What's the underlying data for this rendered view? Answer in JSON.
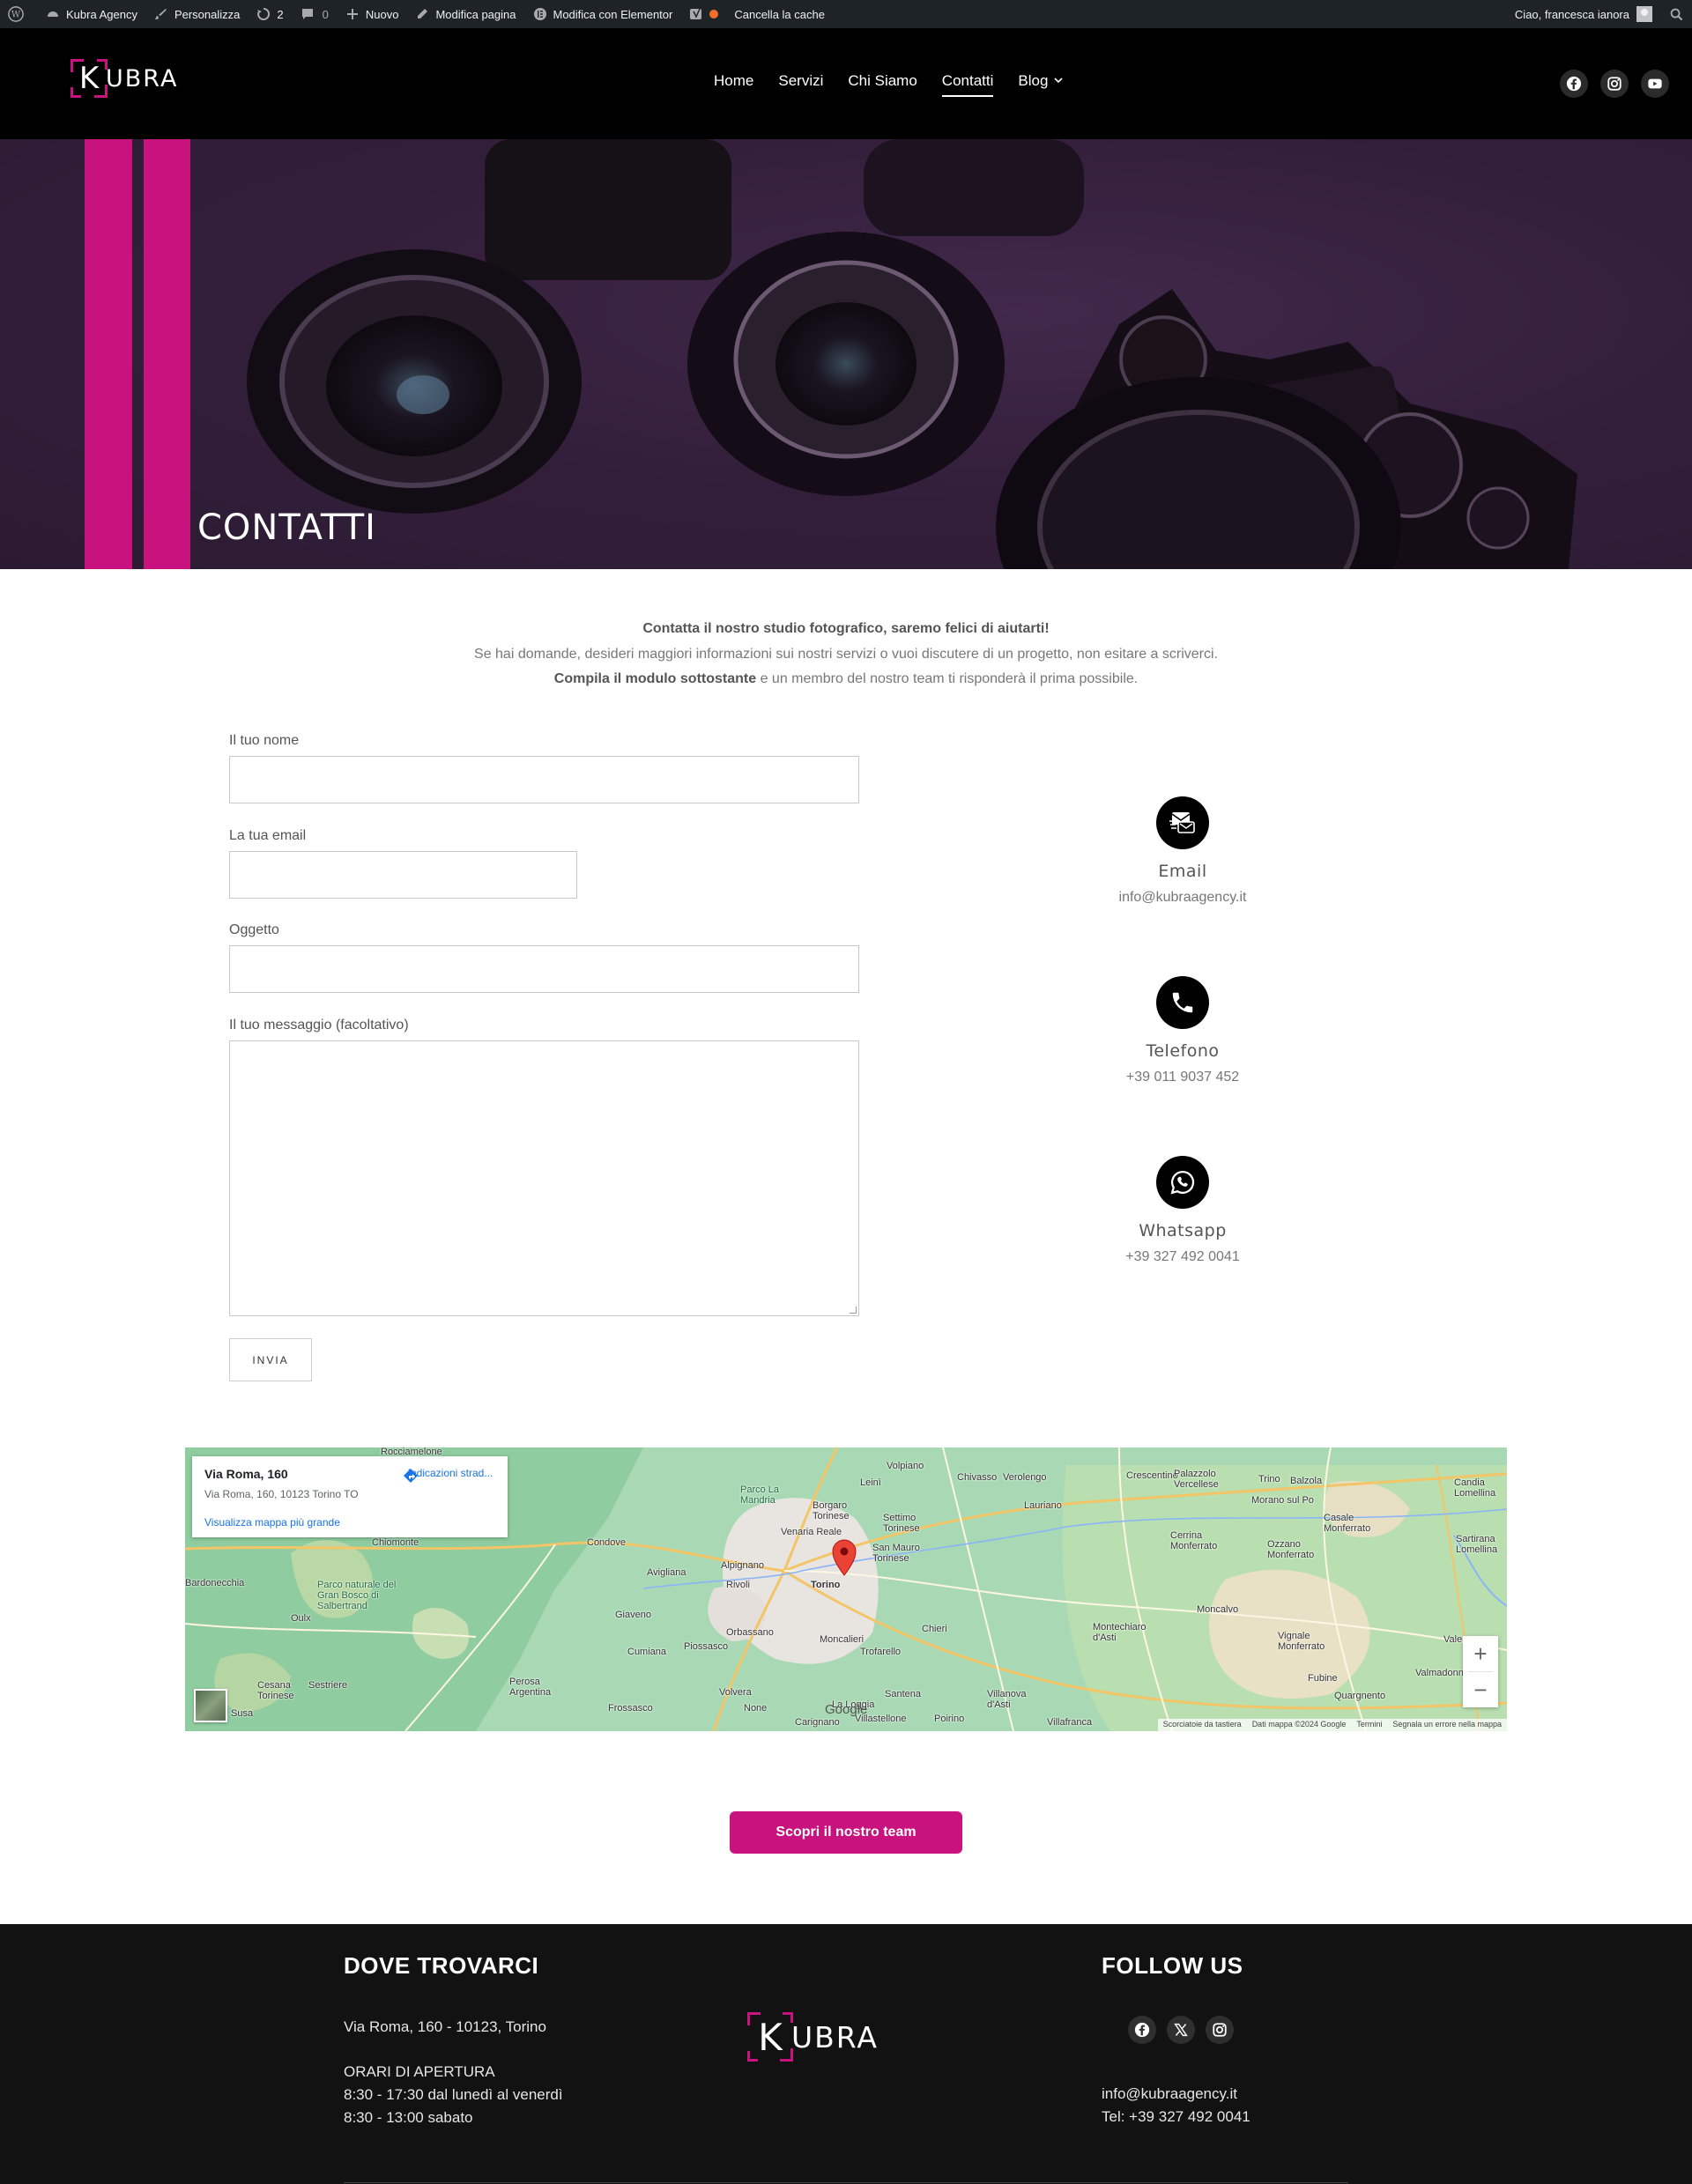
{
  "adminbar": {
    "site": "Kubra Agency",
    "customize": "Personalizza",
    "updates_count": "2",
    "comments_count": "0",
    "new": "Nuovo",
    "edit_page": "Modifica pagina",
    "edit_elementor": "Modifica con Elementor",
    "clear_cache": "Cancella la cache",
    "greeting": "Ciao, francesca ianora"
  },
  "header": {
    "logo_k": "K",
    "logo_rest": "UBRA",
    "nav": [
      {
        "label": "Home"
      },
      {
        "label": "Servizi"
      },
      {
        "label": "Chi Siamo"
      },
      {
        "label": "Contatti"
      },
      {
        "label": "Blog"
      }
    ],
    "active_nav": "Contatti"
  },
  "hero": {
    "title": "CONTATTI"
  },
  "intro": {
    "line1": "Contatta il nostro studio fotografico, saremo felici di aiutarti!",
    "line2": "Se hai domande, desideri maggiori informazioni sui nostri servizi o vuoi discutere di un progetto, non esitare a scriverci.",
    "line3_bold": "Compila il modulo sottostante",
    "line3_rest": " e un membro del nostro team ti risponderà il prima possibile."
  },
  "form": {
    "name_label": "Il tuo nome",
    "name_value": "",
    "email_label": "La tua email",
    "email_value": "",
    "subject_label": "Oggetto",
    "subject_value": "",
    "message_label": "Il tuo messaggio (facoltativo)",
    "message_value": "",
    "submit": "INVIA"
  },
  "contacts": [
    {
      "title": "Email",
      "value": "info@kubraagency.it",
      "icon": "email-icon"
    },
    {
      "title": "Telefono",
      "value": "+39 011 9037 452",
      "icon": "phone-icon"
    },
    {
      "title": "Whatsapp",
      "value": "+39 327 492 0041",
      "icon": "whatsapp-icon"
    }
  ],
  "map": {
    "place_title": "Via Roma, 160",
    "place_address": "Via Roma, 160, 10123 Torino TO",
    "directions": "Indicazioni strad...",
    "bigger_map": "Visualizza mappa più grande",
    "zoom_in": "+",
    "zoom_out": "−",
    "attrib": [
      "Scorciatoie da tastiera",
      "Dati mappa ©2024 Google",
      "Termini",
      "Segnala un errore nella mappa"
    ],
    "google": "Google",
    "labels": [
      "Rocciamelone",
      "Volpiano",
      "Chivasso",
      "Verolengo",
      "Crescentino",
      "Palazzolo Vercellese",
      "Trino",
      "Balzola",
      "Candia Lomellina",
      "Parco La Mandria",
      "Leinì",
      "Borgaro Torinese",
      "Settimo Torinese",
      "Lauriano",
      "Morano sul Po",
      "Casale Monferrato",
      "Venaria Reale",
      "Condove",
      "Chiomonte",
      "Cerrina Monferrato",
      "Ozzano Monferrato",
      "Sartirana Lomellina",
      "Bardonecchia",
      "Parco naturale del Gran Bosco di Salbertrand",
      "Alpignano",
      "Rivoli",
      "San Mauro Torinese",
      "Avigliana",
      "Oulx",
      "Giaveno",
      "Torino",
      "Chieri",
      "Moncalvo",
      "Orbassano",
      "Moncalieri",
      "Montechiaro d'Asti",
      "Vignale Monferrato",
      "Cumiana",
      "Piossasco",
      "Trofarello",
      "Cesana Torinese",
      "Sestriere",
      "Perosa Argentina",
      "Volvera",
      "Santena",
      "Villanova d'Asti",
      "Fubine",
      "Quargnento",
      "Valmadonna",
      "Valenza",
      "Frossasco",
      "None",
      "Villastellone",
      "Poirino",
      "Villafranca",
      "La Loggia",
      "Carignano",
      "Susa"
    ]
  },
  "cta": "Scopri il nostro team",
  "footer": {
    "where_title": "DOVE TROVARCI",
    "address": "Via Roma, 160 - 10123, Torino",
    "hours_title": "ORARI DI APERTURA",
    "hours_1": "8:30 - 17:30 dal lunedì al venerdì",
    "hours_2": "8:30 - 13:00 sabato",
    "follow_title": "FOLLOW US",
    "email": "info@kubraagency.it",
    "tel": "Tel: +39 327 492 0041",
    "logo_k": "K",
    "logo_rest": "UBRA"
  },
  "colors": {
    "brand": "#c8127d",
    "header_bg": "#000000",
    "footer_bg": "#121212",
    "adminbar_bg": "#1d2327"
  }
}
